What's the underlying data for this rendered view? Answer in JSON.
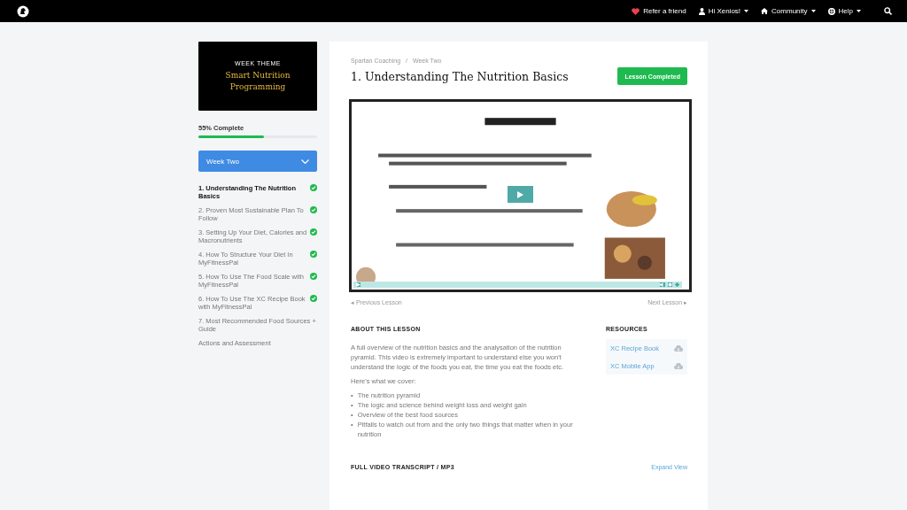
{
  "top_bar": {
    "links": [
      {
        "label": "Refer a friend",
        "dropdown": false
      },
      {
        "label": "Hi Xenios!",
        "dropdown": true
      },
      {
        "label": "Community",
        "dropdown": true
      },
      {
        "label": "Help",
        "dropdown": true
      }
    ]
  },
  "sidebar": {
    "theme_label": "WEEK THEME",
    "theme_title": "Smart Nutrition Programming",
    "progress_label": "55% Complete",
    "progress": {
      "level": 0.55
    },
    "week_dropdown": "Week Two",
    "lessons": [
      {
        "title": "1. Understanding The Nutrition Basics",
        "selected": true,
        "completed": true
      },
      {
        "title": "2. Proven Most Sustainable Plan To Follow",
        "selected": false,
        "completed": true
      },
      {
        "title": "3. Setting Up Your Diet, Calories and Macronutrients",
        "selected": false,
        "completed": true
      },
      {
        "title": "4. How To Structure Your Diet In MyFitnessPal",
        "selected": false,
        "completed": true
      },
      {
        "title": "5. How To Use The Food Scale with MyFitnessPal",
        "selected": false,
        "completed": true
      },
      {
        "title": "6. How To Use The XC Recipe Book with MyFitnessPal",
        "selected": false,
        "completed": true
      },
      {
        "title": "7. Most Recommended Food Sources + Guide",
        "selected": false,
        "completed": false
      },
      {
        "title": "Actions and Assessment",
        "selected": false,
        "completed": false
      }
    ]
  },
  "main": {
    "breadcrumbs": [
      "Spartan Coaching",
      "Week Two"
    ],
    "breadcrumb_separator": "/",
    "bullet": "•",
    "title": "1. Understanding The Nutrition Basics",
    "completed_button": "Lesson Completed",
    "prev_link": "◂ Previous Lesson",
    "next_link": "Next Lesson ▸",
    "about_heading": "ABOUT THIS LESSON",
    "about_text": "A full overview of the nutrition basics and the analysation of the nutrition pyramid. This video is extremely important to understand else you won't understand the logic of the foods you eat, the time you eat the foods etc.",
    "cover_intro": "Here's what we cover:",
    "cover_items": [
      "The nutrition pyramid",
      "The logic and science behind weight loss and weight gain",
      "Overview of the best food sources",
      "Pitfalls to watch out from and the only two things that matter when in your nutrition"
    ],
    "resources_heading": "RESOURCES",
    "resources": [
      "XC Recipe Book",
      "XC Mobile App"
    ],
    "transcript_heading": "FULL VIDEO TRANSCRIPT / MP3",
    "expand_link": "Expand View"
  }
}
